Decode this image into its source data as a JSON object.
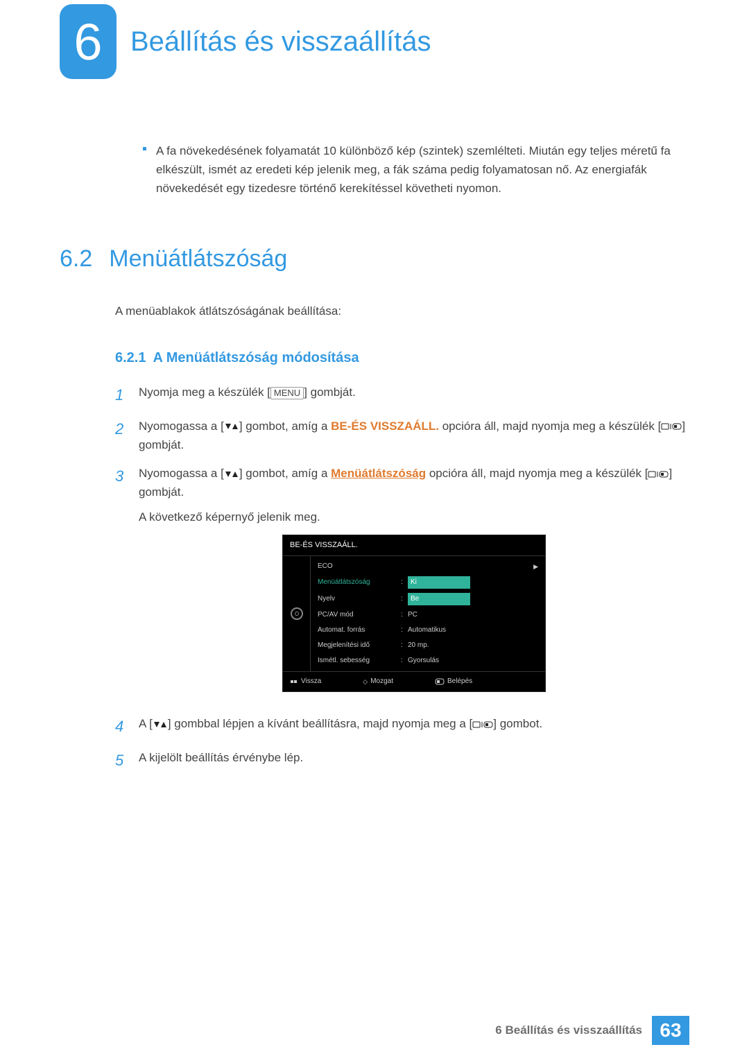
{
  "chapter": {
    "number": "6",
    "title": "Beállítás és visszaállítás"
  },
  "top_bullet": "A fa növekedésének folyamatát 10 különböző kép (szintek) szemlélteti. Miután egy teljes méretű fa elkészült, ismét az eredeti kép jelenik meg, a fák száma pedig folyamatosan nő. Az energiafák növekedését egy tizedesre történő kerekítéssel követheti nyomon.",
  "section": {
    "number": "6.2",
    "title": "Menüátlátszóság",
    "intro": "A menüablakok átlátszóságának beállítása:"
  },
  "subsection": {
    "number": "6.2.1",
    "title": "A Menüátlátszóság módosítása"
  },
  "steps": {
    "s1_a": "Nyomja meg a készülék [",
    "s1_key": "MENU",
    "s1_b": "] gombját.",
    "s2_a": "Nyomogassa a [",
    "s2_b": "] gombot, amíg a ",
    "s2_opt": "BE-ÉS VISSZAÁLL.",
    "s2_c": " opcióra áll, majd nyomja meg a készülék [",
    "s2_d": "] gombját.",
    "s3_a": "Nyomogassa a [",
    "s3_b": "] gombot, amíg a ",
    "s3_opt": "Menüátlátszóság",
    "s3_c": " opcióra áll, majd nyomja meg a készülék [",
    "s3_d": "] gombját.",
    "s3_e": "A következő képernyő jelenik meg.",
    "s4_a": "A [",
    "s4_b": "] gombbal lépjen a kívánt beállításra, majd nyomja meg a [",
    "s4_c": "] gombot.",
    "s5": "A kijelölt beállítás érvénybe lép."
  },
  "osd": {
    "title": "BE-ÉS VISSZAÁLL.",
    "rows": {
      "eco": "ECO",
      "transparency": "Menüátlátszóság",
      "transparency_val_off": "Ki",
      "transparency_val_on": "Be",
      "lang": "Nyelv",
      "pcav": "PC/AV mód",
      "pcav_val": "PC",
      "autosrc": "Automat. forrás",
      "autosrc_val": "Automatikus",
      "disptime": "Megjelenítési idő",
      "disptime_val": "20 mp.",
      "repeat": "Ismétl. sebesség",
      "repeat_val": "Gyorsulás"
    },
    "footer": {
      "back": "Vissza",
      "move": "Mozgat",
      "enter": "Belépés"
    }
  },
  "footer": {
    "text": "6 Beállítás és visszaállítás",
    "page": "63"
  }
}
